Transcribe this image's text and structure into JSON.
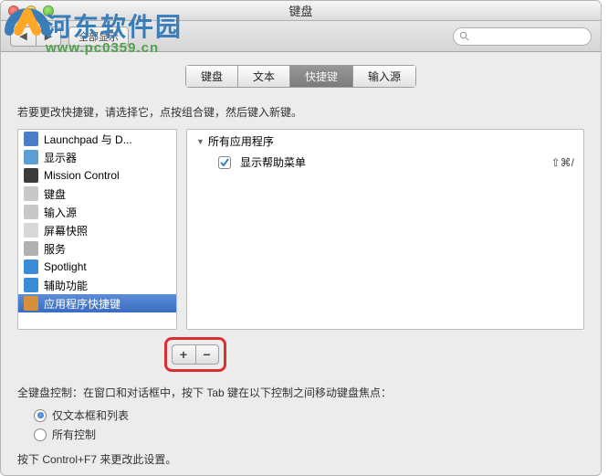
{
  "watermark": {
    "line1": "河东软件园",
    "line2": "www.pc0359.cn"
  },
  "window": {
    "title": "键盘"
  },
  "toolbar": {
    "show_all": "全部显示",
    "search_placeholder": ""
  },
  "tabs": [
    {
      "label": "键盘"
    },
    {
      "label": "文本"
    },
    {
      "label": "快捷键"
    },
    {
      "label": "输入源"
    }
  ],
  "active_tab": 2,
  "hint": "若要更改快捷键，请选择它，点按组合键，然后键入新键。",
  "categories": [
    {
      "label": "Launchpad 与 D...",
      "icon": "launchpad"
    },
    {
      "label": "显示器",
      "icon": "display"
    },
    {
      "label": "Mission Control",
      "icon": "mission"
    },
    {
      "label": "键盘",
      "icon": "keyboard"
    },
    {
      "label": "输入源",
      "icon": "input"
    },
    {
      "label": "屏幕快照",
      "icon": "screenshot"
    },
    {
      "label": "服务",
      "icon": "services"
    },
    {
      "label": "Spotlight",
      "icon": "spotlight"
    },
    {
      "label": "辅助功能",
      "icon": "accessibility"
    },
    {
      "label": "应用程序快捷键",
      "icon": "appstore"
    }
  ],
  "selected_category": 9,
  "right": {
    "group": "所有应用程序",
    "items": [
      {
        "label": "显示帮助菜单",
        "checked": true,
        "shortcut": "⇧⌘/"
      }
    ]
  },
  "buttons": {
    "add": "+",
    "remove": "−"
  },
  "kb_control": {
    "hint": "全键盘控制：在窗口和对话框中，按下 Tab 键在以下控制之间移动键盘焦点：",
    "opt1": "仅文本框和列表",
    "opt2": "所有控制",
    "selected": 0,
    "footer": "按下 Control+F7 来更改此设置。"
  }
}
